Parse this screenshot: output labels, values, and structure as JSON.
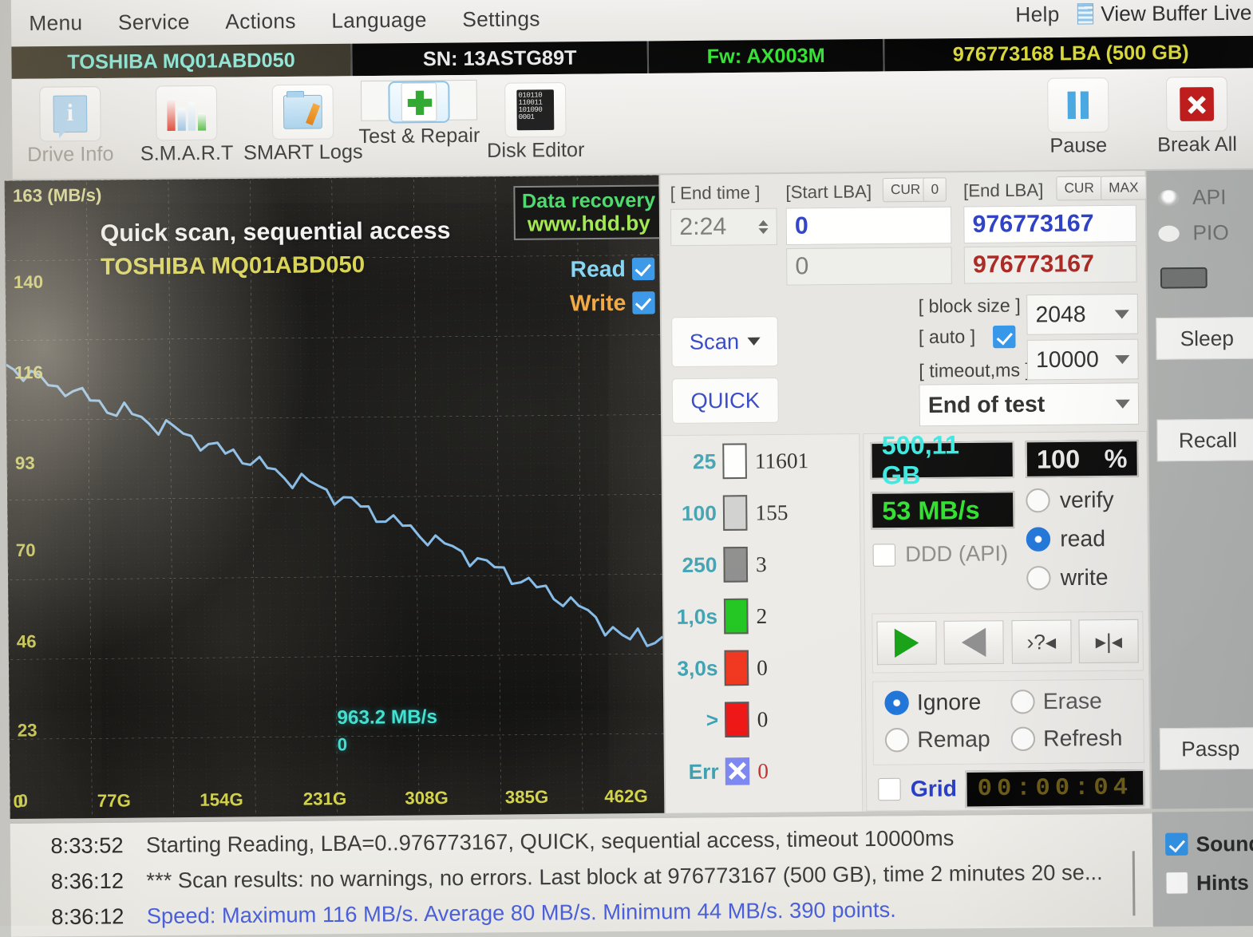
{
  "menubar": {
    "items": [
      "Menu",
      "Service",
      "Actions",
      "Language",
      "Settings",
      "Help"
    ],
    "view_buffer_label": "View Buffer Live",
    "view_buffer_icon": "buffer-lines-icon"
  },
  "drive_bar": {
    "model": "TOSHIBA MQ01ABD050",
    "serial": "SN: 13ASTG89T",
    "firmware": "Fw: AX003M",
    "capacity": "976773168 LBA (500 GB)"
  },
  "toolbar": {
    "buttons": [
      {
        "label": "Drive Info",
        "icon": "drive-info-icon",
        "selected": false,
        "dim": true
      },
      {
        "label": "S.M.A.R.T",
        "icon": "smart-chart-icon",
        "selected": false,
        "dim": false
      },
      {
        "label": "SMART Logs",
        "icon": "smart-logs-folder-icon",
        "selected": false,
        "dim": false
      },
      {
        "label": "Test & Repair",
        "icon": "test-repair-plus-icon",
        "selected": true,
        "dim": false
      },
      {
        "label": "Disk Editor",
        "icon": "disk-editor-binary-icon",
        "selected": false,
        "dim": false
      }
    ],
    "pause_label": "Pause",
    "pause_icon": "pause-icon",
    "break_label": "Break All",
    "break_icon": "close-x-icon"
  },
  "chart_data": {
    "type": "line",
    "title": "Quick scan, sequential access",
    "subtitle": "TOSHIBA MQ01ABD050",
    "xlabel": "",
    "ylabel": "163 (MB/s)",
    "ylim": [
      0,
      163
    ],
    "xlim": [
      0,
      500
    ],
    "grid": true,
    "yticks": [
      "163 (MB/s)",
      "140",
      "116",
      "93",
      "70",
      "46",
      "23",
      "0"
    ],
    "ytick_values": [
      163,
      140,
      116,
      93,
      70,
      46,
      23,
      0
    ],
    "xticks": [
      "0",
      "77G",
      "154G",
      "231G",
      "308G",
      "385G",
      "462G"
    ],
    "xtick_values": [
      0,
      77,
      154,
      231,
      308,
      385,
      462
    ],
    "legend_position": "top-right",
    "series": [
      {
        "name": "Read",
        "color": "#7fb8e8",
        "enabled": true,
        "x": [
          0,
          6,
          13,
          19,
          26,
          32,
          39,
          45,
          51,
          58,
          64,
          71,
          77,
          84,
          90,
          96,
          103,
          109,
          116,
          122,
          128,
          135,
          141,
          148,
          154,
          161,
          167,
          173,
          180,
          186,
          193,
          199,
          205,
          212,
          218,
          225,
          231,
          238,
          244,
          250,
          257,
          263,
          270,
          276,
          282,
          289,
          295,
          302,
          308,
          315,
          321,
          327,
          334,
          340,
          347,
          353,
          359,
          366,
          372,
          379,
          385,
          392,
          398,
          404,
          411,
          417,
          424,
          430,
          436,
          443,
          449,
          456,
          462,
          469,
          475,
          481,
          488,
          494,
          500
        ],
        "y": [
          116,
          115,
          114,
          113,
          112,
          111,
          110,
          110,
          109,
          108,
          107,
          106,
          105,
          104,
          104,
          103,
          102,
          101,
          100,
          100,
          99,
          98,
          97,
          96,
          95,
          94,
          93,
          93,
          92,
          91,
          90,
          89,
          88,
          87,
          86,
          86,
          85,
          84,
          83,
          82,
          81,
          80,
          79,
          78,
          77,
          76,
          75,
          74,
          73,
          72,
          71,
          70,
          69,
          68,
          67,
          66,
          65,
          64,
          63,
          62,
          61,
          60,
          59,
          58,
          57,
          56,
          55,
          54,
          53,
          51,
          50,
          48,
          47,
          45,
          44,
          46,
          45,
          44,
          44
        ]
      },
      {
        "name": "Write",
        "color": "#f0a33b",
        "enabled": true,
        "x": [],
        "y": []
      }
    ],
    "annotations": {
      "current_speed": "963.2 MB/s",
      "current_lba": "0",
      "watermark_line1": "Data recovery",
      "watermark_line2": "www.hdd.by"
    },
    "legend": [
      {
        "label": "Read",
        "checked": true,
        "color": "#7fd2f5"
      },
      {
        "label": "Write",
        "checked": true,
        "color": "#f0a33b"
      }
    ]
  },
  "panel": {
    "end_time_label": "[ End time ]",
    "end_time_value": "2:24",
    "start_lba_label": "[Start LBA]",
    "start_lba_cur": "CUR",
    "start_lba_zero": "0",
    "start_lba_value": "0",
    "start_lba_value2": "0",
    "end_lba_label": "[End LBA]",
    "end_lba_cur": "CUR",
    "end_lba_max": "MAX",
    "end_lba_value": "976773167",
    "end_lba_value2": "976773167",
    "scan_label": "Scan",
    "quick_label": "QUICK",
    "block_size_label": "[ block size ]",
    "block_size_value": "2048",
    "auto_label": "[ auto ]",
    "auto_checked": true,
    "timeout_label": "[ timeout,ms ]",
    "timeout_value": "10000",
    "end_of_test_value": "End of test",
    "dpad": [
      "up-arrow-icon",
      "down-arrow-icon",
      "left-arrow-icon",
      "right-arrow-icon"
    ]
  },
  "stats": {
    "rows": [
      {
        "key": "25",
        "color": "#ffffff",
        "count": "11601"
      },
      {
        "key": "100",
        "color": "#cfcfcf",
        "count": "155"
      },
      {
        "key": "250",
        "color": "#8a8a8a",
        "count": "3"
      },
      {
        "key": "1,0s",
        "color": "#19c419",
        "count": "2"
      },
      {
        "key": "3,0s",
        "color": "#f03018",
        "count": "0"
      },
      {
        "key": ">",
        "color": "#ee1111",
        "count": "0"
      },
      {
        "key": "Err",
        "color": "#7b86f0",
        "count": "0"
      }
    ]
  },
  "readouts": {
    "size": "500,11 GB",
    "percent_value": "100",
    "percent_unit": "%",
    "speed": "53 MB/s",
    "ddd_label": "DDD (API)",
    "ddd_checked": false,
    "mode_options": [
      "verify",
      "read",
      "write"
    ],
    "mode_selected": "read",
    "transport_buttons": [
      "play-icon",
      "reverse-icon",
      "skip-query-icon",
      "skip-end-icon"
    ],
    "transport_labels": [
      "",
      "",
      "›?◂",
      "▸|◂"
    ],
    "error_options": [
      "Ignore",
      "Erase",
      "Remap",
      "Refresh"
    ],
    "error_selected": "Ignore",
    "grid_label": "Grid",
    "grid_checked": false,
    "timer": "00:00:04"
  },
  "sidebar": {
    "api_label": "API",
    "pio_label": "PIO",
    "status_pill": "status-pill-icon",
    "sleep_label": "Sleep",
    "recall_label": "Recall",
    "passp_label": "Passp"
  },
  "log": {
    "lines": [
      {
        "time": "8:33:52",
        "text": "Starting Reading, LBA=0..976773167, QUICK, sequential access, timeout 10000ms",
        "blue": false
      },
      {
        "time": "8:36:12",
        "text": "*** Scan results: no warnings, no errors. Last block at 976773167 (500 GB), time 2 minutes 20 se...",
        "blue": false
      },
      {
        "time": "8:36:12",
        "text": "Speed: Maximum 116 MB/s. Average 80 MB/s. Minimum 44 MB/s. 390 points.",
        "blue": true
      }
    ]
  },
  "footer": {
    "sound_label": "Sound",
    "sound_checked": true,
    "hints_label": "Hints",
    "hints_checked": false
  }
}
